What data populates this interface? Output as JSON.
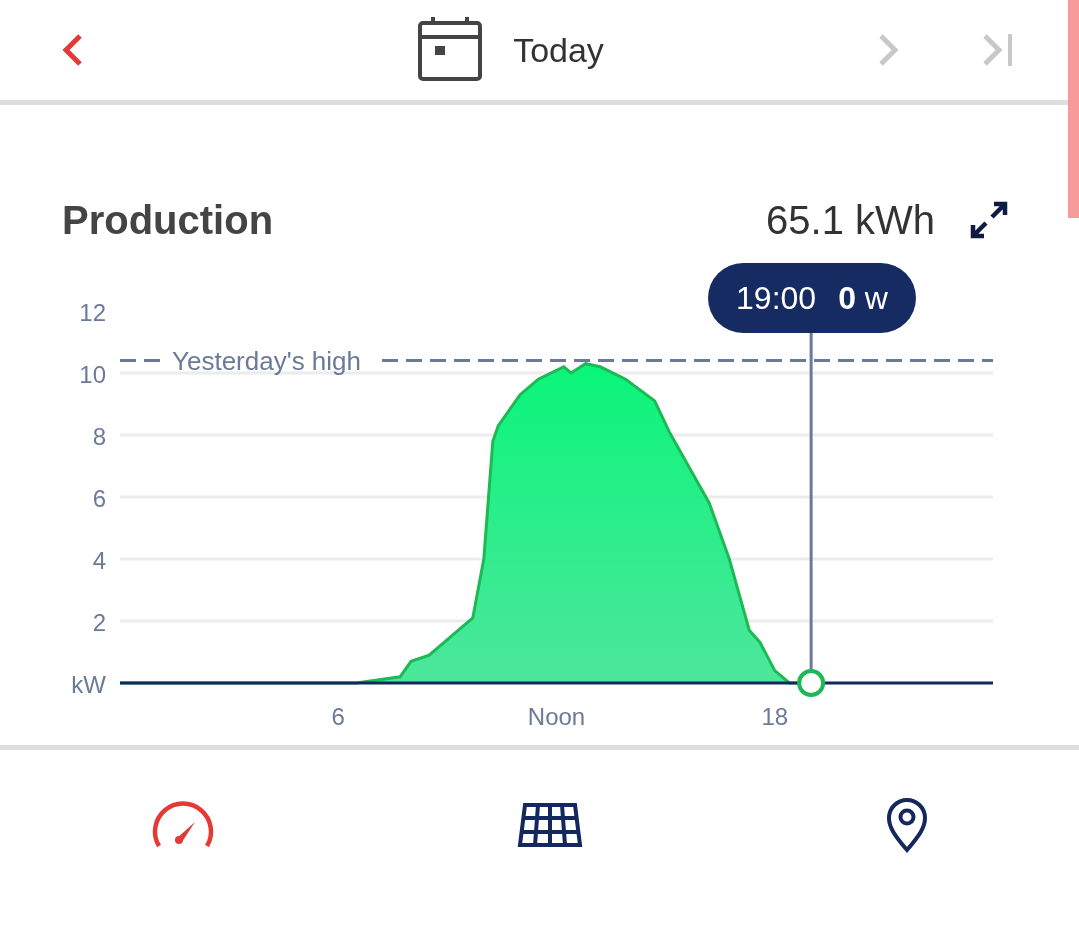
{
  "header": {
    "title": "Today",
    "prev": {
      "disabled": false
    },
    "next": {
      "disabled": true
    },
    "last": {
      "disabled": true
    }
  },
  "production": {
    "title": "Production",
    "total": "65.1 kWh",
    "tooltip": {
      "time": "19:00",
      "value": "**0** w"
    },
    "chart_data": {
      "type": "area",
      "x": [
        0,
        6.5,
        7.7,
        8.0,
        8.5,
        9.2,
        9.7,
        10.0,
        10.25,
        10.4,
        11.0,
        11.5,
        12.2,
        12.4,
        12.8,
        13.2,
        13.9,
        14.7,
        15.1,
        16.2,
        16.75,
        17.3,
        17.6,
        18.0,
        18.4,
        19.0
      ],
      "series": [
        {
          "color": "#1db954",
          "values": [
            0,
            0,
            0.2,
            0.7,
            0.9,
            1.6,
            2.1,
            4.0,
            7.8,
            8.3,
            9.3,
            9.8,
            10.2,
            10.0,
            10.3,
            10.2,
            9.8,
            9.1,
            8.1,
            5.8,
            4.0,
            1.7,
            1.3,
            0.4,
            0,
            0
          ]
        }
      ],
      "xlim": [
        0,
        24
      ],
      "ylim": [
        0,
        12
      ],
      "xticks": [
        6,
        {
          "value": 12,
          "label": "Noon"
        },
        18
      ],
      "yticks": [
        {
          "value": 0,
          "label": "kW"
        },
        2,
        4,
        6,
        8,
        10,
        12
      ],
      "grid": true,
      "ref_lines": [
        {
          "axis": "y",
          "value": 10.4,
          "label": "Yesterday's high"
        },
        {
          "axis": "x",
          "value": 19
        }
      ]
    }
  },
  "nav": [
    {
      "kind": "gauge",
      "selected": true
    },
    {
      "kind": "panel",
      "selected": false
    },
    {
      "kind": "pin",
      "selected": false
    }
  ]
}
